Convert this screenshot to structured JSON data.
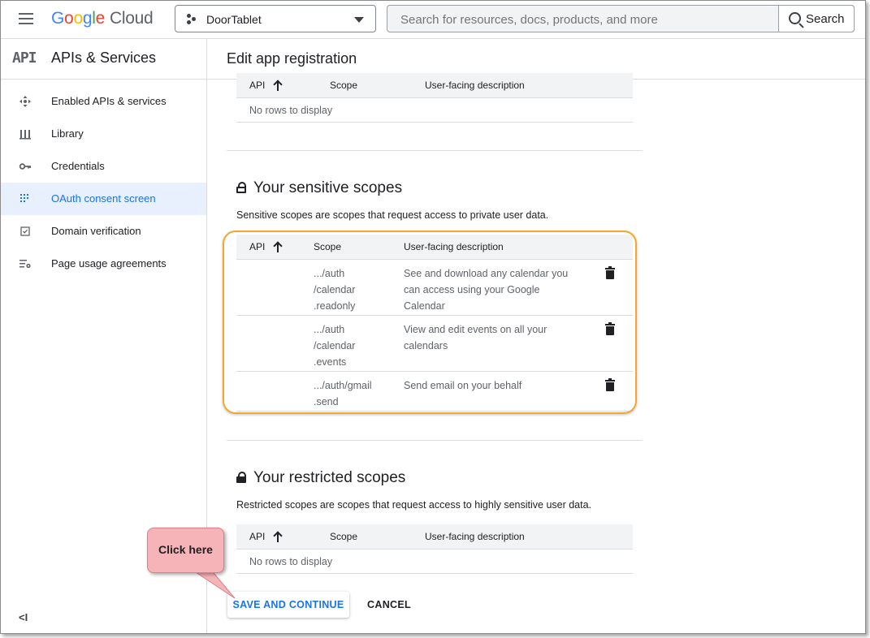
{
  "topbar": {
    "brand_google": [
      "G",
      "o",
      "o",
      "g",
      "l",
      "e"
    ],
    "brand_cloud": "Cloud",
    "project_name": "DoorTablet",
    "search_placeholder": "Search for resources, docs, products, and more",
    "search_button": "Search"
  },
  "sidebar": {
    "logo_text": "API",
    "title": "APIs & Services",
    "items": [
      {
        "label": "Enabled APIs & services",
        "icon": "move-icon"
      },
      {
        "label": "Library",
        "icon": "library-icon"
      },
      {
        "label": "Credentials",
        "icon": "key-icon"
      },
      {
        "label": "OAuth consent screen",
        "icon": "consent-icon",
        "active": true
      },
      {
        "label": "Domain verification",
        "icon": "checkbox-icon"
      },
      {
        "label": "Page usage agreements",
        "icon": "settings-list-icon"
      }
    ],
    "collapse_label": "<I"
  },
  "page": {
    "title": "Edit app registration"
  },
  "non_sensitive_table": {
    "headers": {
      "api": "API",
      "scope": "Scope",
      "description": "User-facing description"
    },
    "empty_text": "No rows to display"
  },
  "sensitive": {
    "title": "Your sensitive scopes",
    "description": "Sensitive scopes are scopes that request access to private user data.",
    "headers": {
      "api": "API",
      "scope": "Scope",
      "description": "User-facing description"
    },
    "rows": [
      {
        "scope": ".../auth /calendar .readonly",
        "description": "See and download any calendar you can access using your Google Calendar"
      },
      {
        "scope": ".../auth /calendar .events",
        "description": "View and edit events on all your calendars"
      },
      {
        "scope": ".../auth/gmail .send",
        "description": "Send email on your behalf"
      }
    ]
  },
  "restricted": {
    "title": "Your restricted scopes",
    "description": "Restricted scopes are scopes that request access to highly sensitive user data.",
    "headers": {
      "api": "API",
      "scope": "Scope",
      "description": "User-facing description"
    },
    "empty_text": "No rows to display"
  },
  "actions": {
    "save": "SAVE AND CONTINUE",
    "cancel": "CANCEL"
  },
  "callout": {
    "text": "Click here"
  },
  "colors": {
    "accent": "#1a73e8",
    "highlight": "#f0a830",
    "callout": "#f6b3b8"
  }
}
